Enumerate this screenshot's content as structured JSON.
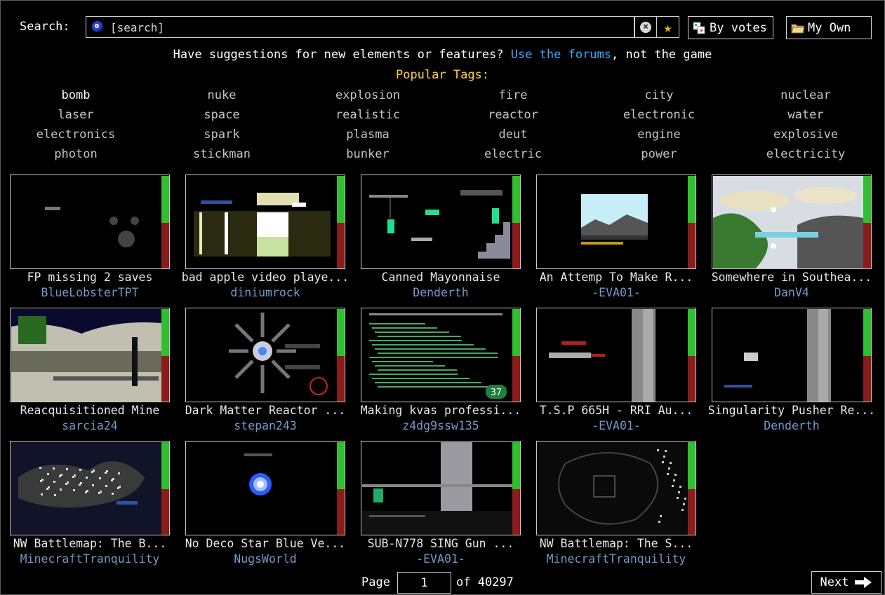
{
  "search": {
    "label": "Search:",
    "placeholder": "[search]"
  },
  "toolbar": {
    "by_votes_label": "By votes",
    "my_own_label": "My Own",
    "fav_icon": "star-icon",
    "clear_icon": "clear-icon"
  },
  "notice": {
    "prefix": "Have suggestions for new elements or features? ",
    "link": "Use the forums",
    "suffix": ", not the game"
  },
  "popular_tags_title": "Popular Tags:",
  "tags": [
    [
      "bomb",
      "nuke",
      "explosion",
      "fire",
      "city",
      "nuclear"
    ],
    [
      "laser",
      "space",
      "realistic",
      "reactor",
      "electronic",
      "water"
    ],
    [
      "electronics",
      "spark",
      "plasma",
      "deut",
      "engine",
      "explosive"
    ],
    [
      "photon",
      "stickman",
      "bunker",
      "electric",
      "power",
      "electricity"
    ]
  ],
  "saves": [
    {
      "title": "FP missing 2 saves",
      "author": "BlueLobsterTPT",
      "score_fraction": 0.5
    },
    {
      "title": "bad apple video playe...",
      "author": "diniumrock",
      "score_fraction": 0.5
    },
    {
      "title": "Canned Mayonnaise",
      "author": "Denderth",
      "score_fraction": 0.5
    },
    {
      "title": "An Attemp To Make R...",
      "author": "-EVA01-",
      "score_fraction": 0.5
    },
    {
      "title": "Somewhere in Southea...",
      "author": "DanV4",
      "score_fraction": 0.5
    },
    {
      "title": "Reacquisitioned Mine",
      "author": "sarcia24",
      "score_fraction": 0.5
    },
    {
      "title": "Dark Matter Reactor ...",
      "author": "stepan243",
      "score_fraction": 0.5
    },
    {
      "title": "Making kvas professi...",
      "author": "z4dg9ssw135",
      "score_fraction": 0.5,
      "badge": "37"
    },
    {
      "title": "T.S.P 665H - RRI Au...",
      "author": "-EVA01-",
      "score_fraction": 0.5
    },
    {
      "title": "Singularity Pusher Re...",
      "author": "Denderth",
      "score_fraction": 0.5
    },
    {
      "title": "NW Battlemap: The B...",
      "author": "MinecraftTranquility",
      "score_fraction": 0.5
    },
    {
      "title": "No Deco Star Blue Ve...",
      "author": "NugsWorld",
      "score_fraction": 0.5
    },
    {
      "title": "SUB-N778 SING Gun ...",
      "author": "-EVA01-",
      "score_fraction": 0.5
    },
    {
      "title": "NW Battlemap: The S...",
      "author": "MinecraftTranquility",
      "score_fraction": 0.5
    }
  ],
  "pagination": {
    "label": "Page",
    "current": "1",
    "of_label": "of 40297",
    "next_label": "Next"
  },
  "colors": {
    "link": "#38a8ff",
    "tags_title": "#ffd03a",
    "author": "#7898c8",
    "vote_up": "#2fbf2f",
    "vote_down": "#8a1c1c"
  }
}
